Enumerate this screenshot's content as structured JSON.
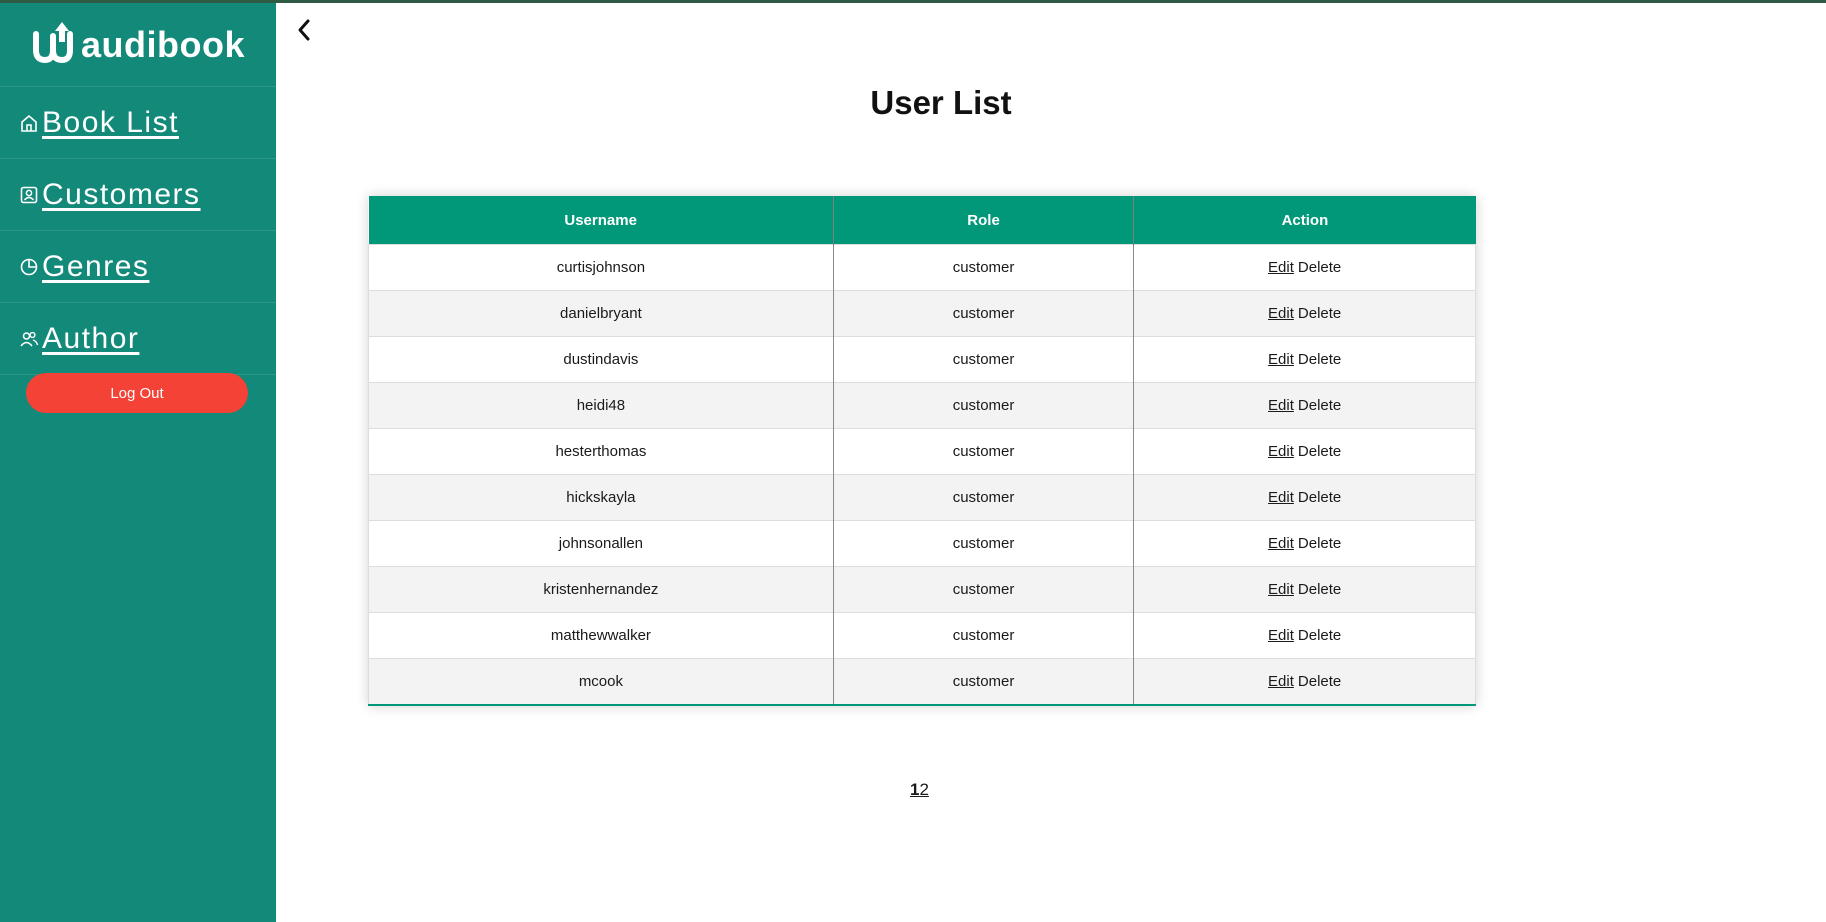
{
  "app": {
    "logo_text": "audibook",
    "brand_color": "#13897a",
    "logo_icon": "audibook-logo-icon"
  },
  "sidebar": {
    "items": [
      {
        "label": "Book List",
        "icon": "home-icon"
      },
      {
        "label": "Customers",
        "icon": "user-card-icon"
      },
      {
        "label": "Genres",
        "icon": "pie-chart-icon"
      },
      {
        "label": "Author",
        "icon": "users-icon"
      }
    ],
    "logout_label": "Log Out",
    "logout_color": "#f44236"
  },
  "header": {
    "back_icon": "chevron-left-icon"
  },
  "main": {
    "title": "User List",
    "table": {
      "header_color": "#009879",
      "columns": [
        "Username",
        "Role",
        "Action"
      ],
      "rows": [
        {
          "username": "curtisjohnson",
          "role": "customer",
          "edit": "Edit",
          "delete": "Delete"
        },
        {
          "username": "danielbryant",
          "role": "customer",
          "edit": "Edit",
          "delete": "Delete"
        },
        {
          "username": "dustindavis",
          "role": "customer",
          "edit": "Edit",
          "delete": "Delete"
        },
        {
          "username": "heidi48",
          "role": "customer",
          "edit": "Edit",
          "delete": "Delete"
        },
        {
          "username": "hesterthomas",
          "role": "customer",
          "edit": "Edit",
          "delete": "Delete"
        },
        {
          "username": "hickskayla",
          "role": "customer",
          "edit": "Edit",
          "delete": "Delete"
        },
        {
          "username": "johnsonallen",
          "role": "customer",
          "edit": "Edit",
          "delete": "Delete"
        },
        {
          "username": "kristenhernandez",
          "role": "customer",
          "edit": "Edit",
          "delete": "Delete"
        },
        {
          "username": "matthewwalker",
          "role": "customer",
          "edit": "Edit",
          "delete": "Delete"
        },
        {
          "username": "mcook",
          "role": "customer",
          "edit": "Edit",
          "delete": "Delete"
        }
      ]
    },
    "pagination": {
      "pages": [
        "1",
        "2"
      ],
      "current": "1"
    }
  }
}
